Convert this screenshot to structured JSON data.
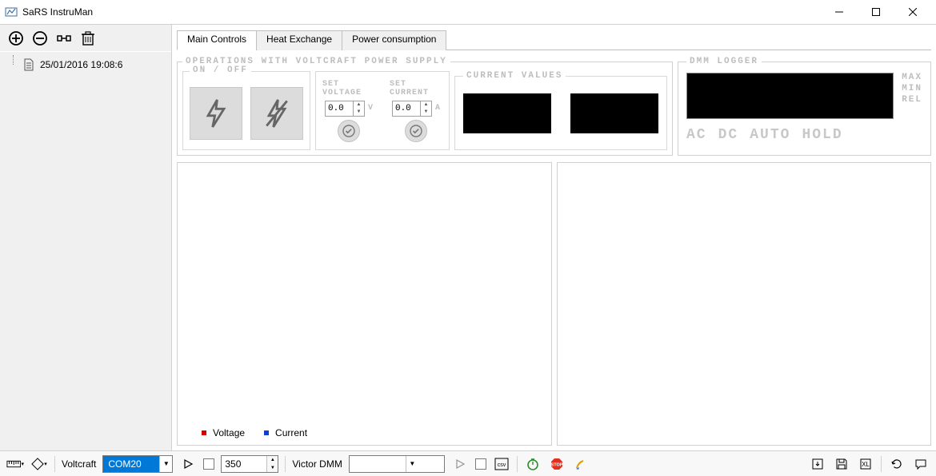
{
  "window": {
    "title": "SaRS InstruMan"
  },
  "sidebar": {
    "items": [
      {
        "label": "25/01/2016 19:08:6"
      }
    ]
  },
  "tabs": [
    {
      "label": "Main Controls",
      "active": true
    },
    {
      "label": "Heat Exchange",
      "active": false
    },
    {
      "label": "Power consumption",
      "active": false
    }
  ],
  "ops": {
    "title": "OPERATIONS WITH VOLTCRAFT POWER SUPPLY",
    "onoff_label": "ON / OFF",
    "set_voltage_label": "SET VOLTAGE",
    "set_current_label": "SET CURRENT",
    "voltage_value": "0.0",
    "voltage_unit": "V",
    "current_value": "0.0",
    "current_unit": "A"
  },
  "current_values": {
    "title": "CURRENT VALUES"
  },
  "dmm": {
    "title": "DMM LOGGER",
    "side": {
      "max": "MAX",
      "min": "MIN",
      "rel": "REL"
    },
    "modes": {
      "ac": "AC",
      "dc": "DC",
      "auto": "AUTO",
      "hold": "HOLD"
    }
  },
  "chart_legend": [
    {
      "label": "Voltage",
      "color": "#d00000"
    },
    {
      "label": "Current",
      "color": "#1040d0"
    }
  ],
  "statusbar": {
    "voltcraft_label": "Voltcraft",
    "voltcraft_port": "COM20",
    "interval": "350",
    "victor_label": "Victor DMM",
    "victor_port": ""
  }
}
